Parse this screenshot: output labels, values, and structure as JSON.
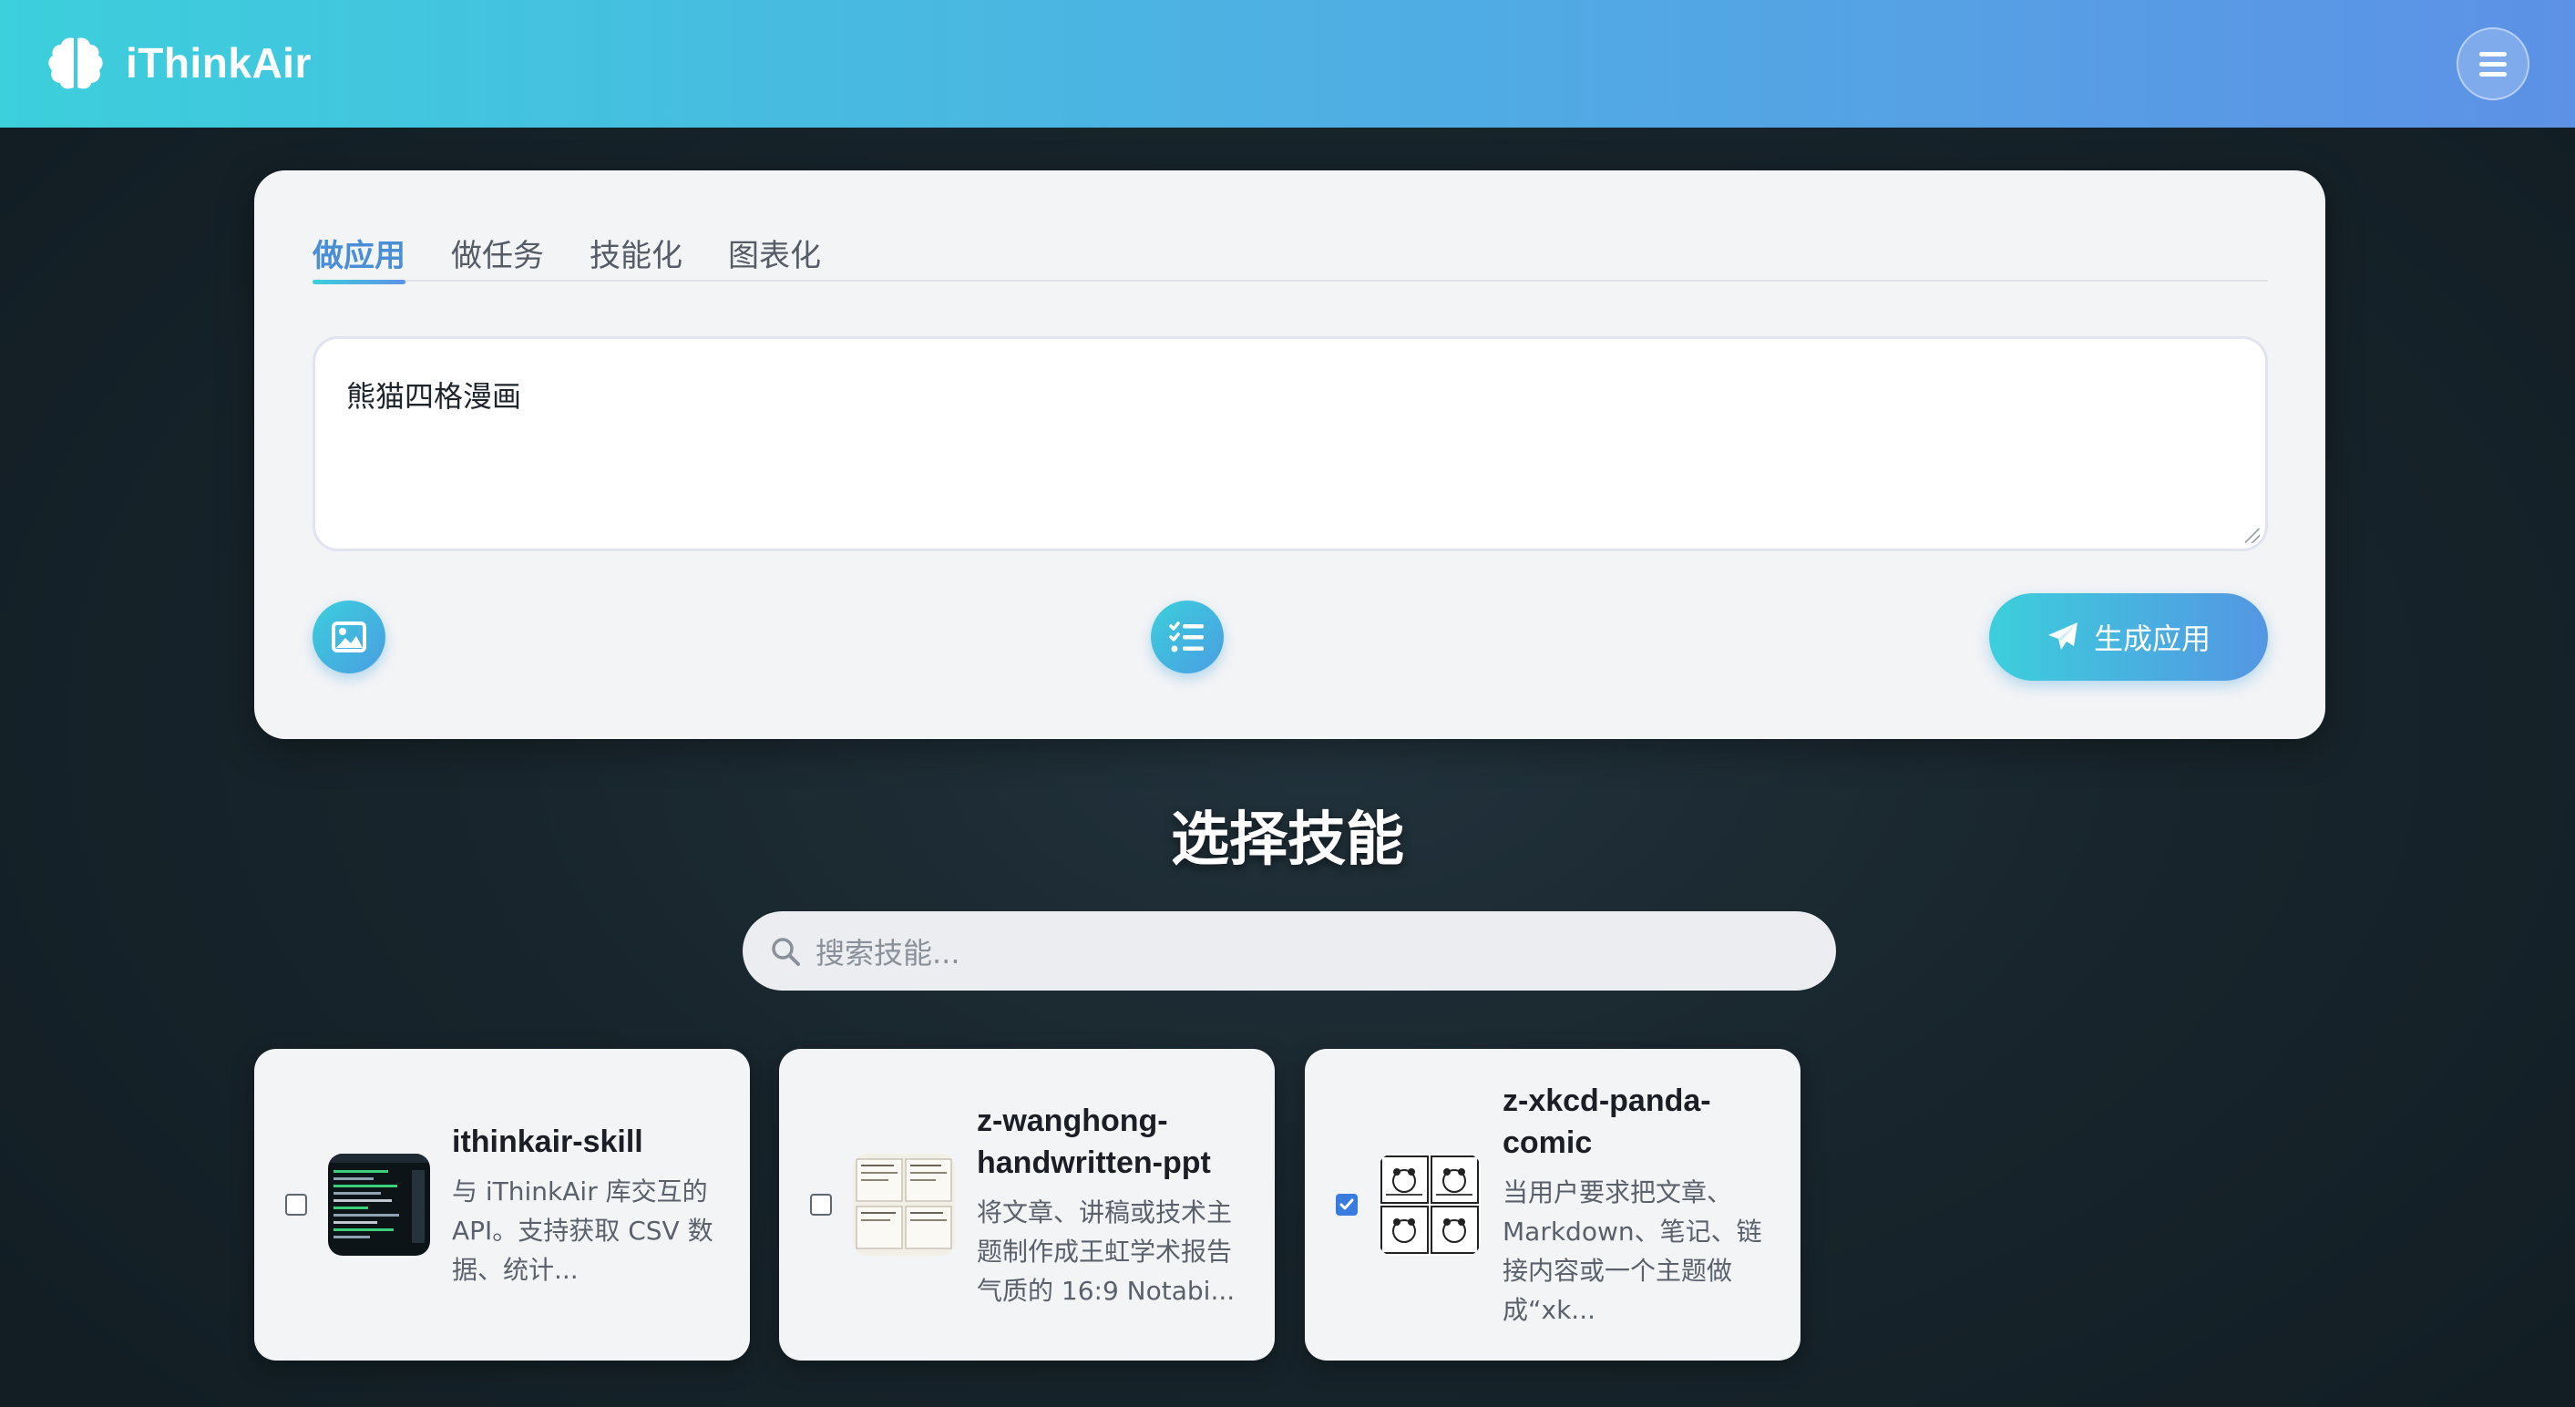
{
  "header": {
    "brand_name": "iThinkAir",
    "brand_icon": "brain-icon",
    "menu_icon": "hamburger-menu-icon"
  },
  "composer": {
    "tabs": [
      {
        "label": "做应用",
        "active": true
      },
      {
        "label": "做任务",
        "active": false
      },
      {
        "label": "技能化",
        "active": false
      },
      {
        "label": "图表化",
        "active": false
      }
    ],
    "prompt_value": "熊猫四格漫画",
    "image_button_icon": "image-icon",
    "list_button_icon": "checklist-icon",
    "generate_label": "生成应用",
    "generate_icon": "paper-plane-icon"
  },
  "skills": {
    "title": "选择技能",
    "search_placeholder": "搜索技能...",
    "items": [
      {
        "name": "ithinkair-skill",
        "description": "与 iThinkAir 库交互的 API。支持获取 CSV 数据、统计...",
        "checked": false
      },
      {
        "name": "z-wanghong-handwritten-ppt",
        "description": "将文章、讲稿或技术主题制作成王虹学术报告气质的 16:9 Notabi...",
        "checked": false
      },
      {
        "name": "z-xkcd-panda-comic",
        "description": "当用户要求把文章、Markdown、笔记、链接内容或一个主题做成“xk...",
        "checked": true
      }
    ]
  },
  "colors": {
    "accent_cyan": "#3ccfdc",
    "accent_blue": "#5d91e6",
    "active_tab": "#4a8ed6",
    "background_dark": "#18252c"
  }
}
